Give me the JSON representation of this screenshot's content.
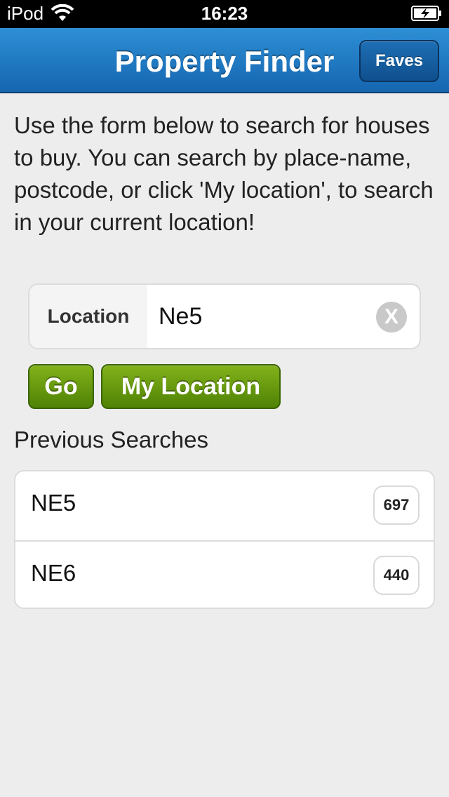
{
  "status_bar": {
    "carrier": "iPod",
    "time": "16:23"
  },
  "header": {
    "title": "Property Finder",
    "faves_label": "Faves"
  },
  "intro_text": "Use the form below to search for houses to buy. You can search by place-name, postcode, or click 'My location', to search in your current location!",
  "search": {
    "label": "Location",
    "value": "Ne5",
    "clear_symbol": "X"
  },
  "buttons": {
    "go_label": "Go",
    "my_location_label": "My Location"
  },
  "previous_searches": {
    "heading": "Previous Searches",
    "items": [
      {
        "name": "NE5",
        "count": "697"
      },
      {
        "name": "NE6",
        "count": "440"
      }
    ]
  },
  "colors": {
    "header_blue": "#1c78c4",
    "button_green": "#6a9b10",
    "background": "#ededed"
  }
}
